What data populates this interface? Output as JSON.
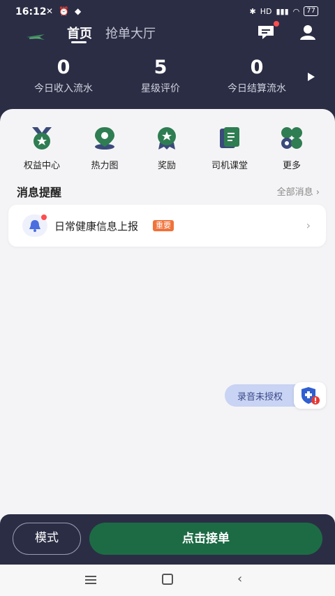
{
  "status_bar": {
    "time": "16:12",
    "battery": "77",
    "network_label": "HD"
  },
  "header": {
    "tabs": [
      {
        "label": "首页",
        "active": true
      },
      {
        "label": "抢单大厅",
        "active": false
      }
    ]
  },
  "stats": [
    {
      "value": "0",
      "label": "今日收入流水"
    },
    {
      "value": "5",
      "label": "星级评价"
    },
    {
      "value": "0",
      "label": "今日结算流水"
    }
  ],
  "quick_menu": [
    {
      "label": "权益中心",
      "icon": "medal-icon"
    },
    {
      "label": "热力图",
      "icon": "location-pin-icon"
    },
    {
      "label": "奖励",
      "icon": "star-badge-icon"
    },
    {
      "label": "司机课堂",
      "icon": "book-icon"
    },
    {
      "label": "更多",
      "icon": "more-apps-icon"
    }
  ],
  "messages": {
    "title": "消息提醒",
    "all_link": "全部消息",
    "items": [
      {
        "text": "日常健康信息上报",
        "tag": "重要"
      }
    ]
  },
  "recording": {
    "label": "录音未授权"
  },
  "bottom_bar": {
    "mode_label": "模式",
    "accept_label": "点击接单"
  },
  "colors": {
    "header_bg": "#2b2d45",
    "accent_green": "#1d6b45",
    "tag_orange": "#f0723a",
    "alert_red": "#ff4d4f"
  }
}
